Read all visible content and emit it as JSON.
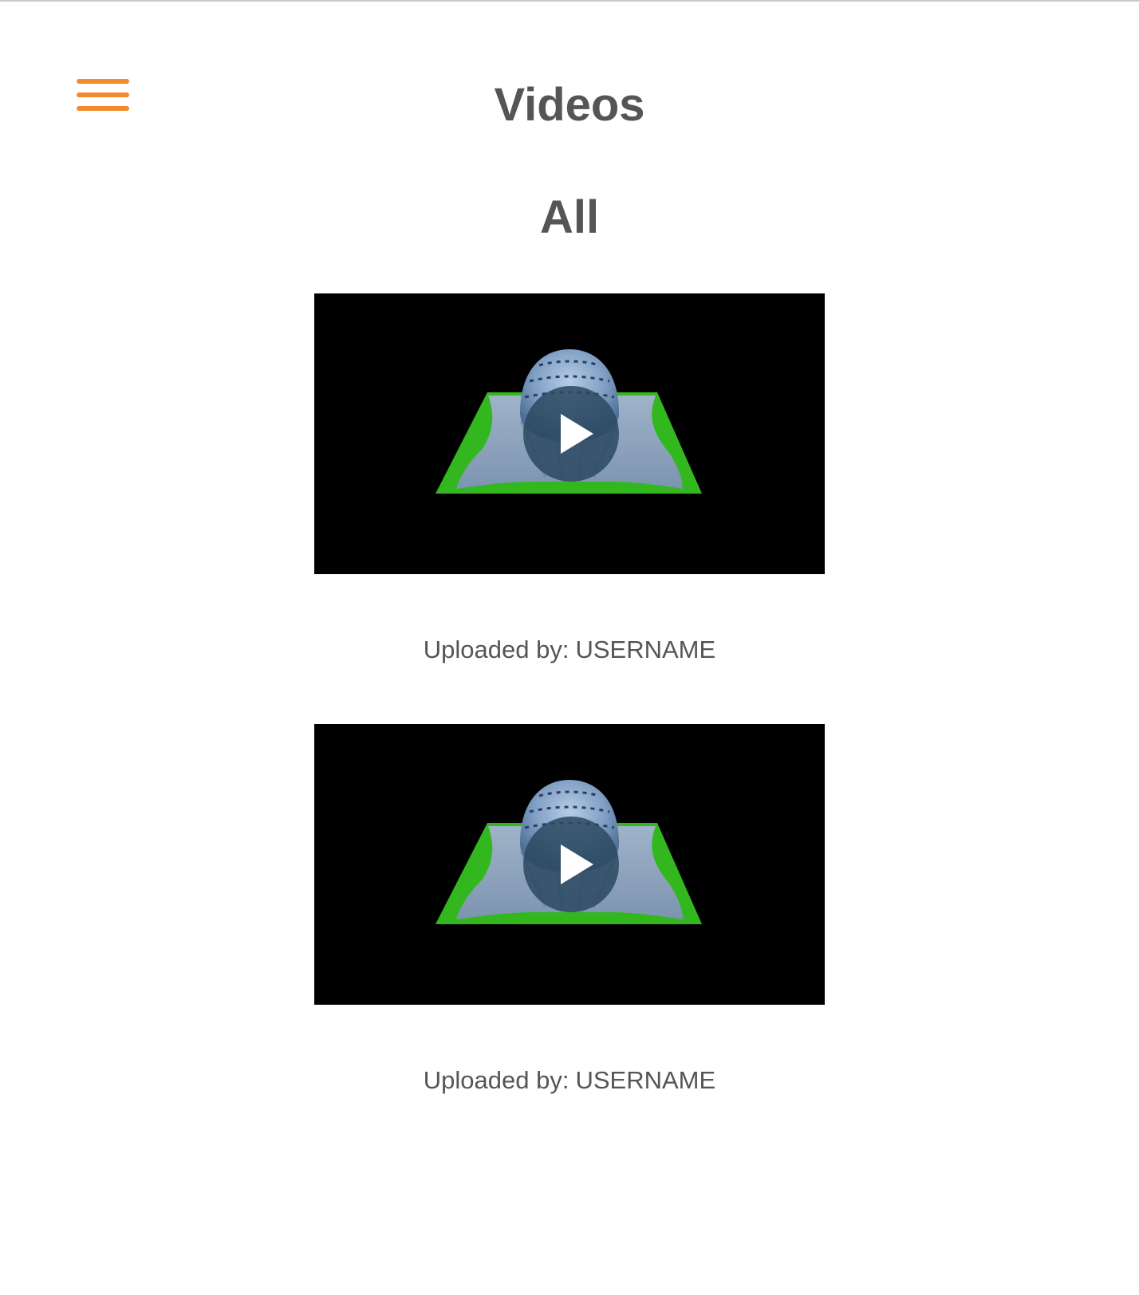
{
  "colors": {
    "accent": "#f28a30",
    "text": "#555555",
    "video_background": "#000000",
    "ground_green": "#33b71f"
  },
  "header": {
    "menu_icon": "hamburger-menu-icon",
    "title": "Videos"
  },
  "section": {
    "title": "All"
  },
  "videos": [
    {
      "uploader_prefix": "Uploaded by:",
      "uploader": "USERNAME",
      "play_icon": "play-icon"
    },
    {
      "uploader_prefix": "Uploaded by:",
      "uploader": "USERNAME",
      "play_icon": "play-icon"
    }
  ]
}
